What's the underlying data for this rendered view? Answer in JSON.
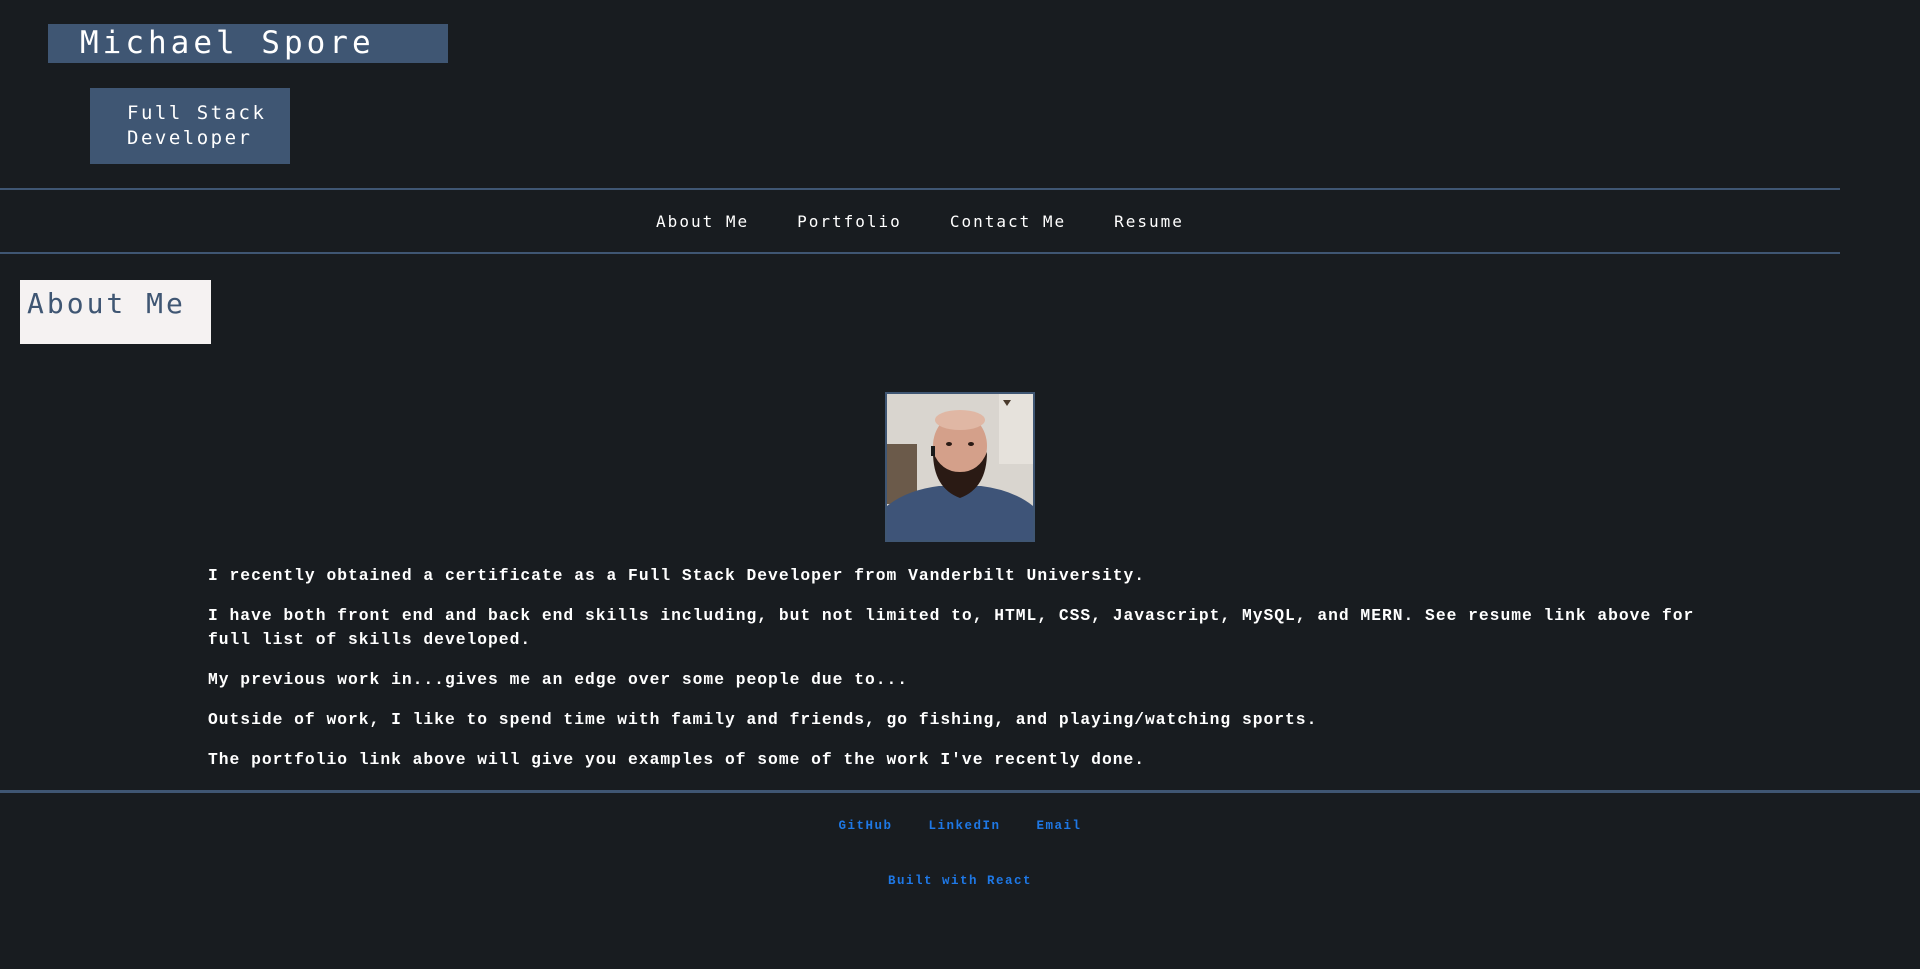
{
  "header": {
    "name": "Michael Spore",
    "role": "Full Stack Developer"
  },
  "nav": {
    "items": [
      {
        "label": "About Me"
      },
      {
        "label": "Portfolio"
      },
      {
        "label": "Contact Me"
      },
      {
        "label": "Resume"
      }
    ]
  },
  "about": {
    "heading": "About Me",
    "photo_alt": "profile-photo",
    "paragraphs": [
      "I recently obtained a certificate as a Full Stack Developer from Vanderbilt University.",
      "I have both front end and back end skills including, but not limited to, HTML, CSS, Javascript, MySQL, and MERN. See resume link above for full list of skills developed.",
      "My previous work in...gives me an edge over some people due to...",
      "Outside of work, I like to spend time with family and friends, go fishing, and playing/watching sports.",
      "The portfolio link above will give you examples of some of the work I've recently done."
    ]
  },
  "footer": {
    "links": [
      {
        "label": "GitHub"
      },
      {
        "label": "LinkedIn"
      },
      {
        "label": "Email"
      }
    ],
    "built_with": "Built with React"
  },
  "colors": {
    "background": "#181c20",
    "accent": "#3f5673",
    "link": "#1e78e6",
    "heading_bg": "#f5f2f2"
  }
}
